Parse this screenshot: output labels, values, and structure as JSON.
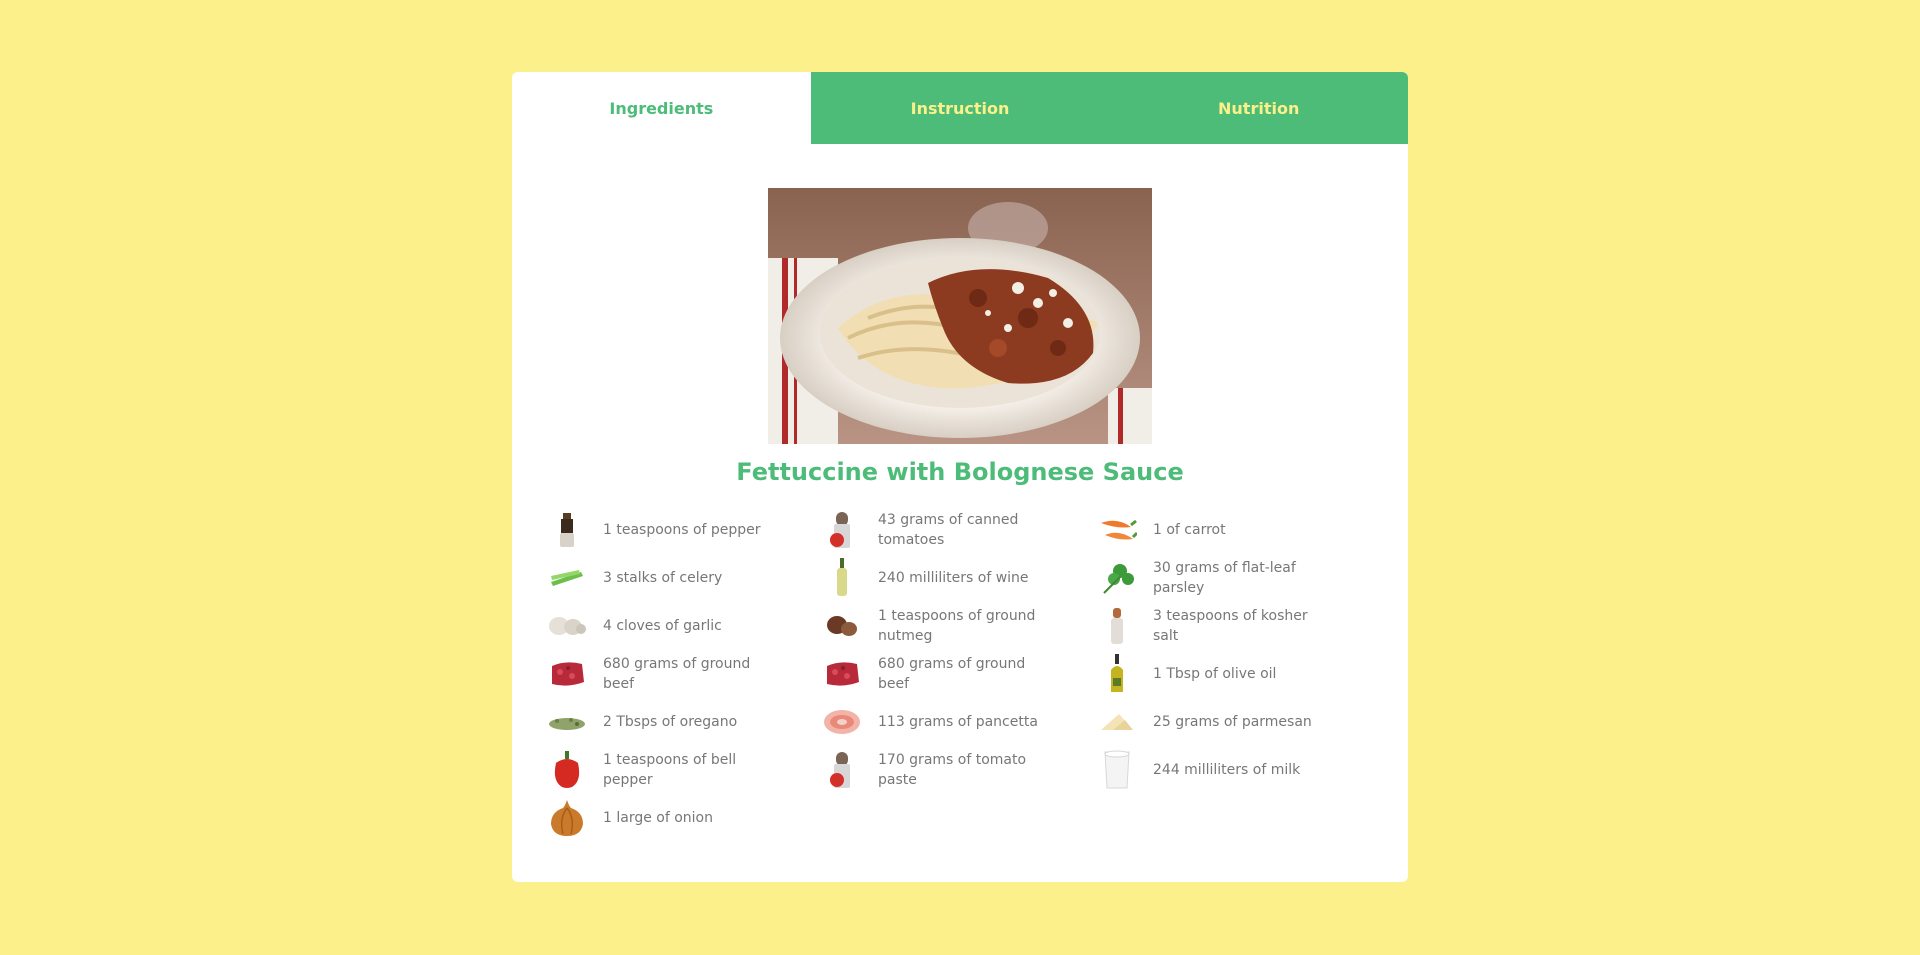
{
  "tabs": [
    {
      "label": "Ingredients"
    },
    {
      "label": "Instruction"
    },
    {
      "label": "Nutrition"
    }
  ],
  "recipe": {
    "title": "Fettuccine with Bolognese Sauce",
    "ingredients": [
      {
        "text": "1 teaspoons of pepper",
        "icon": "pepper-grinder-icon"
      },
      {
        "text": "43 grams of canned tomatoes",
        "icon": "canned-tomato-icon"
      },
      {
        "text": "1 of carrot",
        "icon": "carrot-icon"
      },
      {
        "text": "3 stalks of celery",
        "icon": "celery-icon"
      },
      {
        "text": "240 milliliters of wine",
        "icon": "wine-bottle-icon"
      },
      {
        "text": "30 grams of flat-leaf parsley",
        "icon": "parsley-icon"
      },
      {
        "text": "4 cloves of garlic",
        "icon": "garlic-icon"
      },
      {
        "text": "1 teaspoons of ground nutmeg",
        "icon": "nutmeg-icon"
      },
      {
        "text": "3 teaspoons of kosher salt",
        "icon": "salt-shaker-icon"
      },
      {
        "text": "680 grams of ground beef",
        "icon": "ground-beef-icon"
      },
      {
        "text": "680 grams of ground beef",
        "icon": "ground-beef-icon"
      },
      {
        "text": "1 Tbsp of olive oil",
        "icon": "olive-oil-icon"
      },
      {
        "text": "2 Tbsps of oregano",
        "icon": "oregano-icon"
      },
      {
        "text": "113 grams of pancetta",
        "icon": "pancetta-icon"
      },
      {
        "text": "25 grams of parmesan",
        "icon": "parmesan-icon"
      },
      {
        "text": "1 teaspoons of bell pepper",
        "icon": "bell-pepper-icon"
      },
      {
        "text": "170 grams of tomato paste",
        "icon": "tomato-paste-icon"
      },
      {
        "text": "244 milliliters of milk",
        "icon": "milk-glass-icon"
      },
      {
        "text": "1 large of onion",
        "icon": "onion-icon"
      }
    ]
  },
  "colors": {
    "background": "#fbf089",
    "accent": "#4cbc78",
    "tab_text": "#fbf089",
    "ingredient_text": "#777777"
  }
}
